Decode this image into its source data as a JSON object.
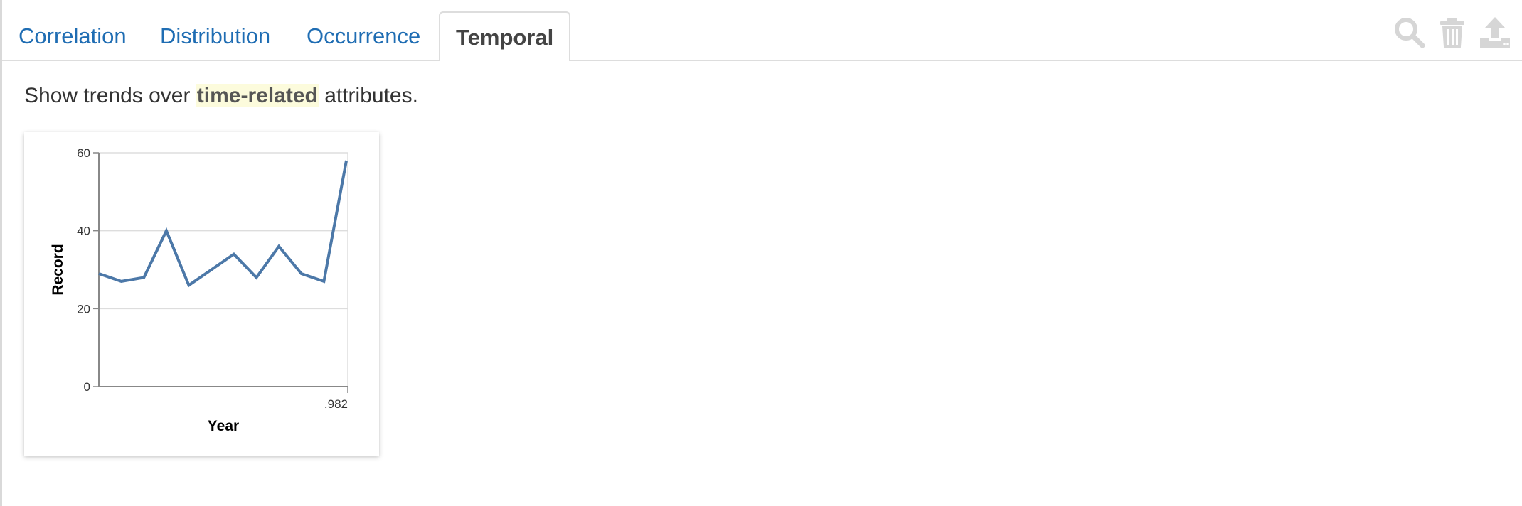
{
  "tabs": [
    {
      "label": "Correlation",
      "active": false
    },
    {
      "label": "Distribution",
      "active": false
    },
    {
      "label": "Occurrence",
      "active": false
    },
    {
      "label": "Temporal",
      "active": true
    }
  ],
  "toolbar": {
    "icons": [
      "search-icon",
      "trash-icon",
      "export-icon"
    ],
    "icon_color": "#d6d6d6"
  },
  "description": {
    "prefix": "Show trends over ",
    "highlight": "time-related",
    "suffix": " attributes."
  },
  "colors": {
    "link": "#1f6db3",
    "line": "#4c78a8",
    "highlight_bg": "#fcfbdc"
  },
  "chart_data": {
    "type": "line",
    "xlabel": "Year",
    "ylabel": "Record",
    "x_tick_labels": [
      ".982"
    ],
    "y_ticks": [
      0,
      20,
      40,
      60
    ],
    "ylim": [
      0,
      60
    ],
    "grid": true,
    "series": [
      {
        "values": [
          29,
          27,
          28,
          40,
          26,
          30,
          34,
          28,
          36,
          29,
          27,
          58
        ]
      }
    ]
  }
}
